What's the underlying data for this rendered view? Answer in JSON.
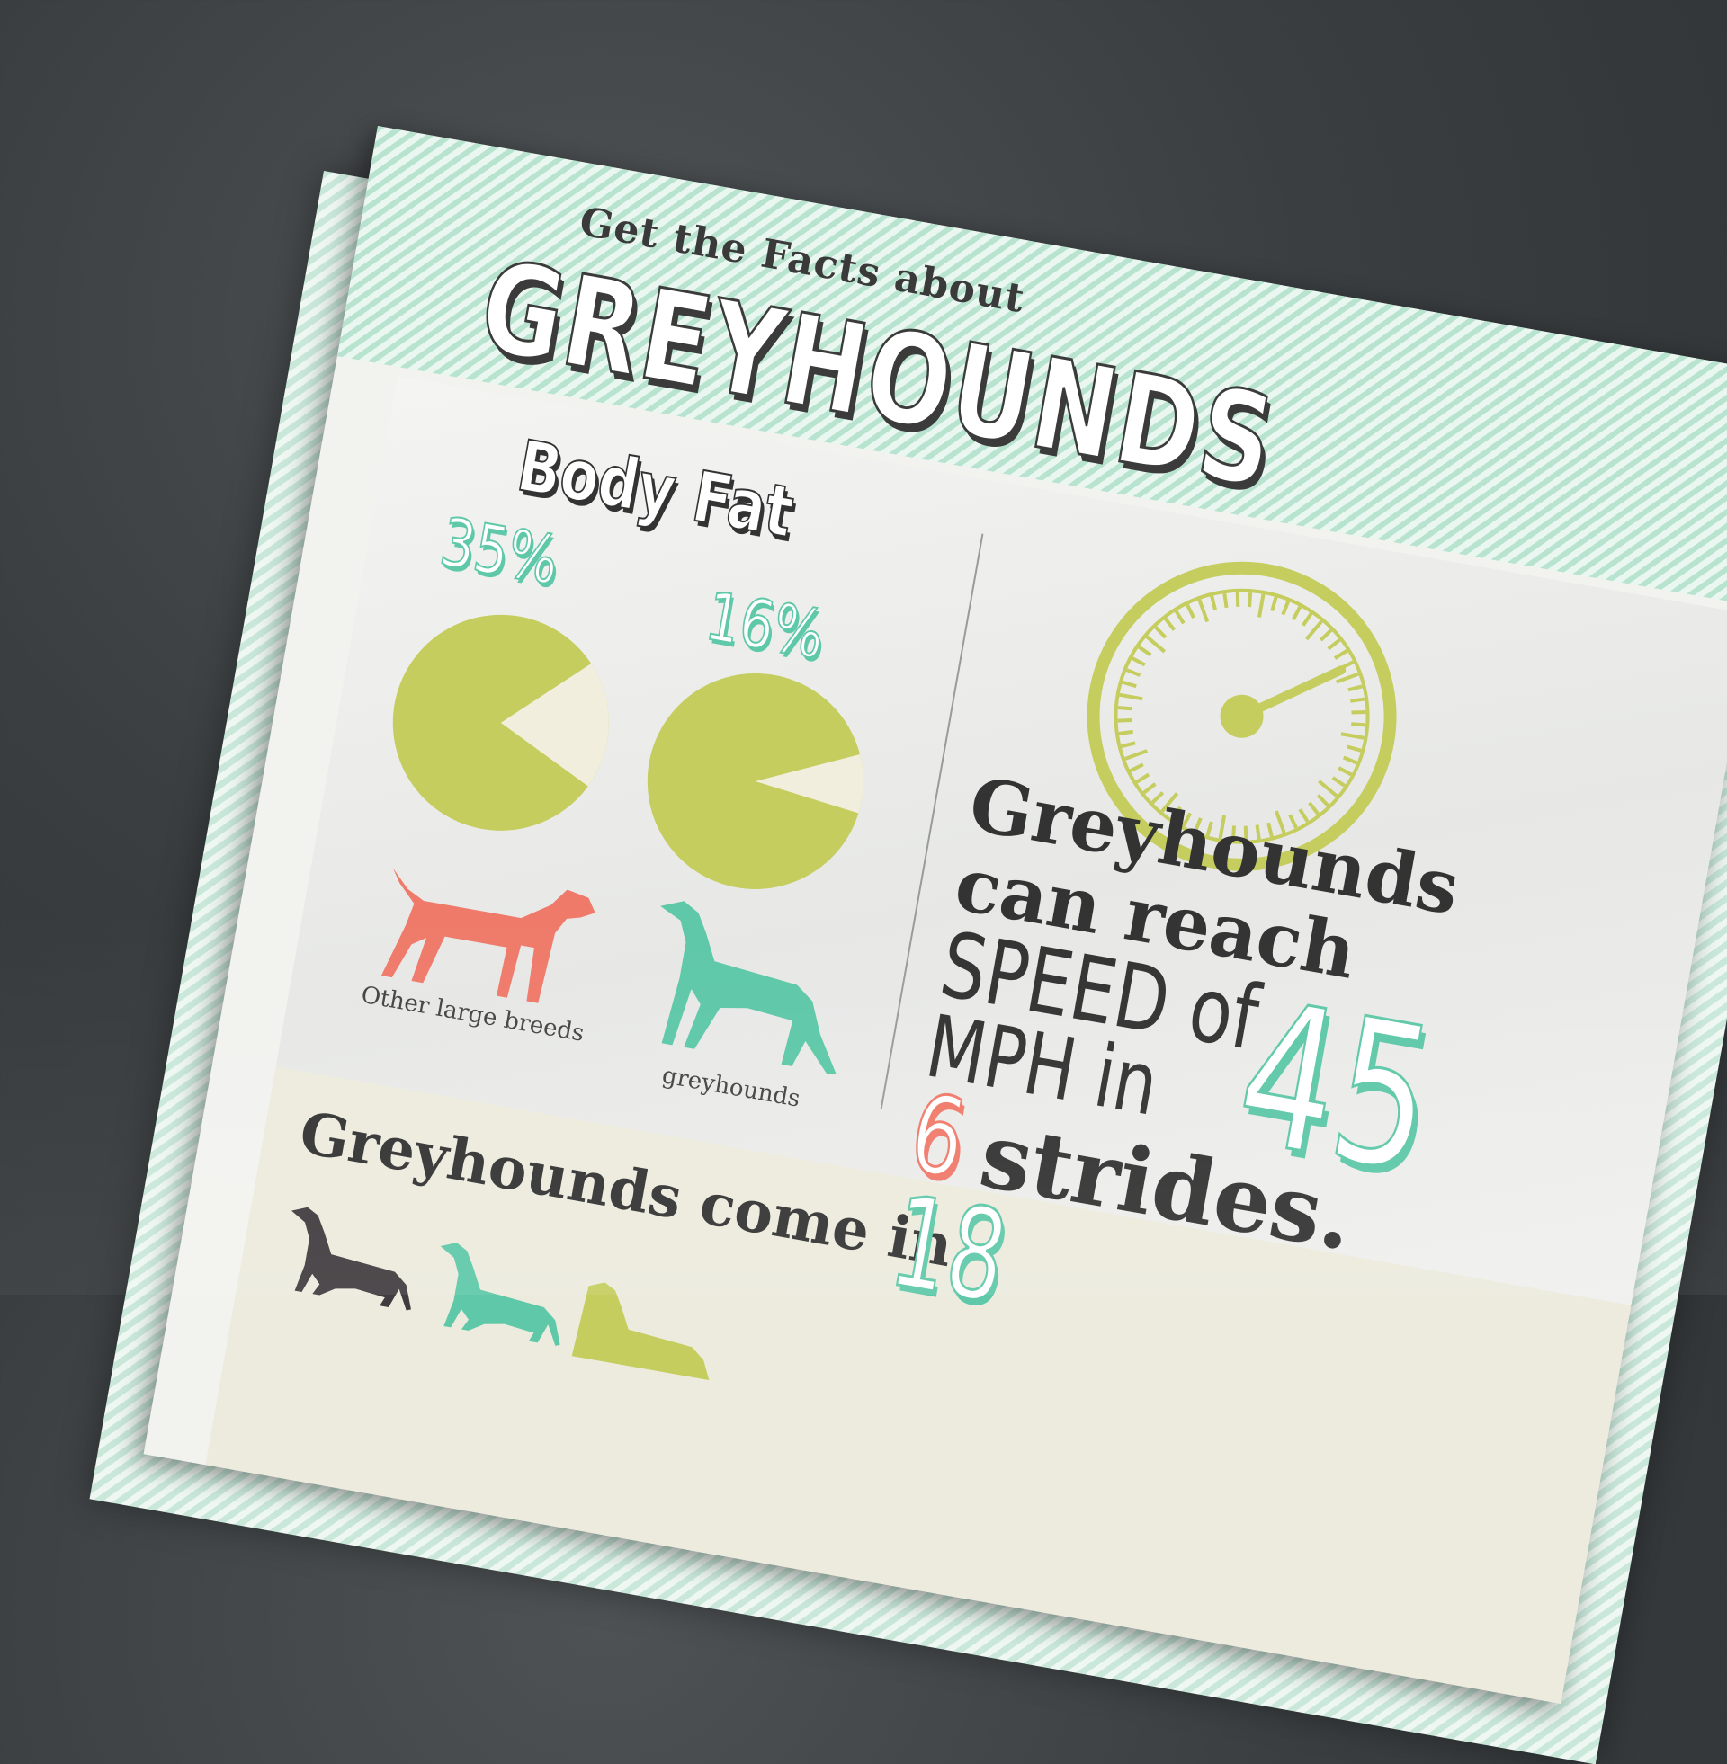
{
  "poster": {
    "subtitle": "Get the Facts about",
    "title": "GREYHOUNDS",
    "body_fat": {
      "heading": "Body Fat",
      "items": [
        {
          "percent": "35%",
          "value": 0.35,
          "label": "Other large breeds",
          "color": "#ef7a6a"
        },
        {
          "percent": "16%",
          "value": 0.16,
          "label": "greyhounds",
          "color": "#5ec8a8"
        }
      ],
      "pie_color": "#c5cd5e",
      "slice_color": "#f1eedd"
    },
    "speed": {
      "line1": "Greyhounds",
      "line2": "can reach",
      "line3": "SPEED of",
      "line4": "MPH in",
      "mph": "45",
      "strides_num": "6",
      "strides_word": "strides.",
      "gauge_color": "#c5cd5e"
    },
    "colors": {
      "text": "Greyhounds come in",
      "count": "18"
    },
    "palette": {
      "mint": "#5ec8a8",
      "coral": "#ef7a6a",
      "olive": "#c5cd5e",
      "dark": "#3b3b3b"
    }
  }
}
